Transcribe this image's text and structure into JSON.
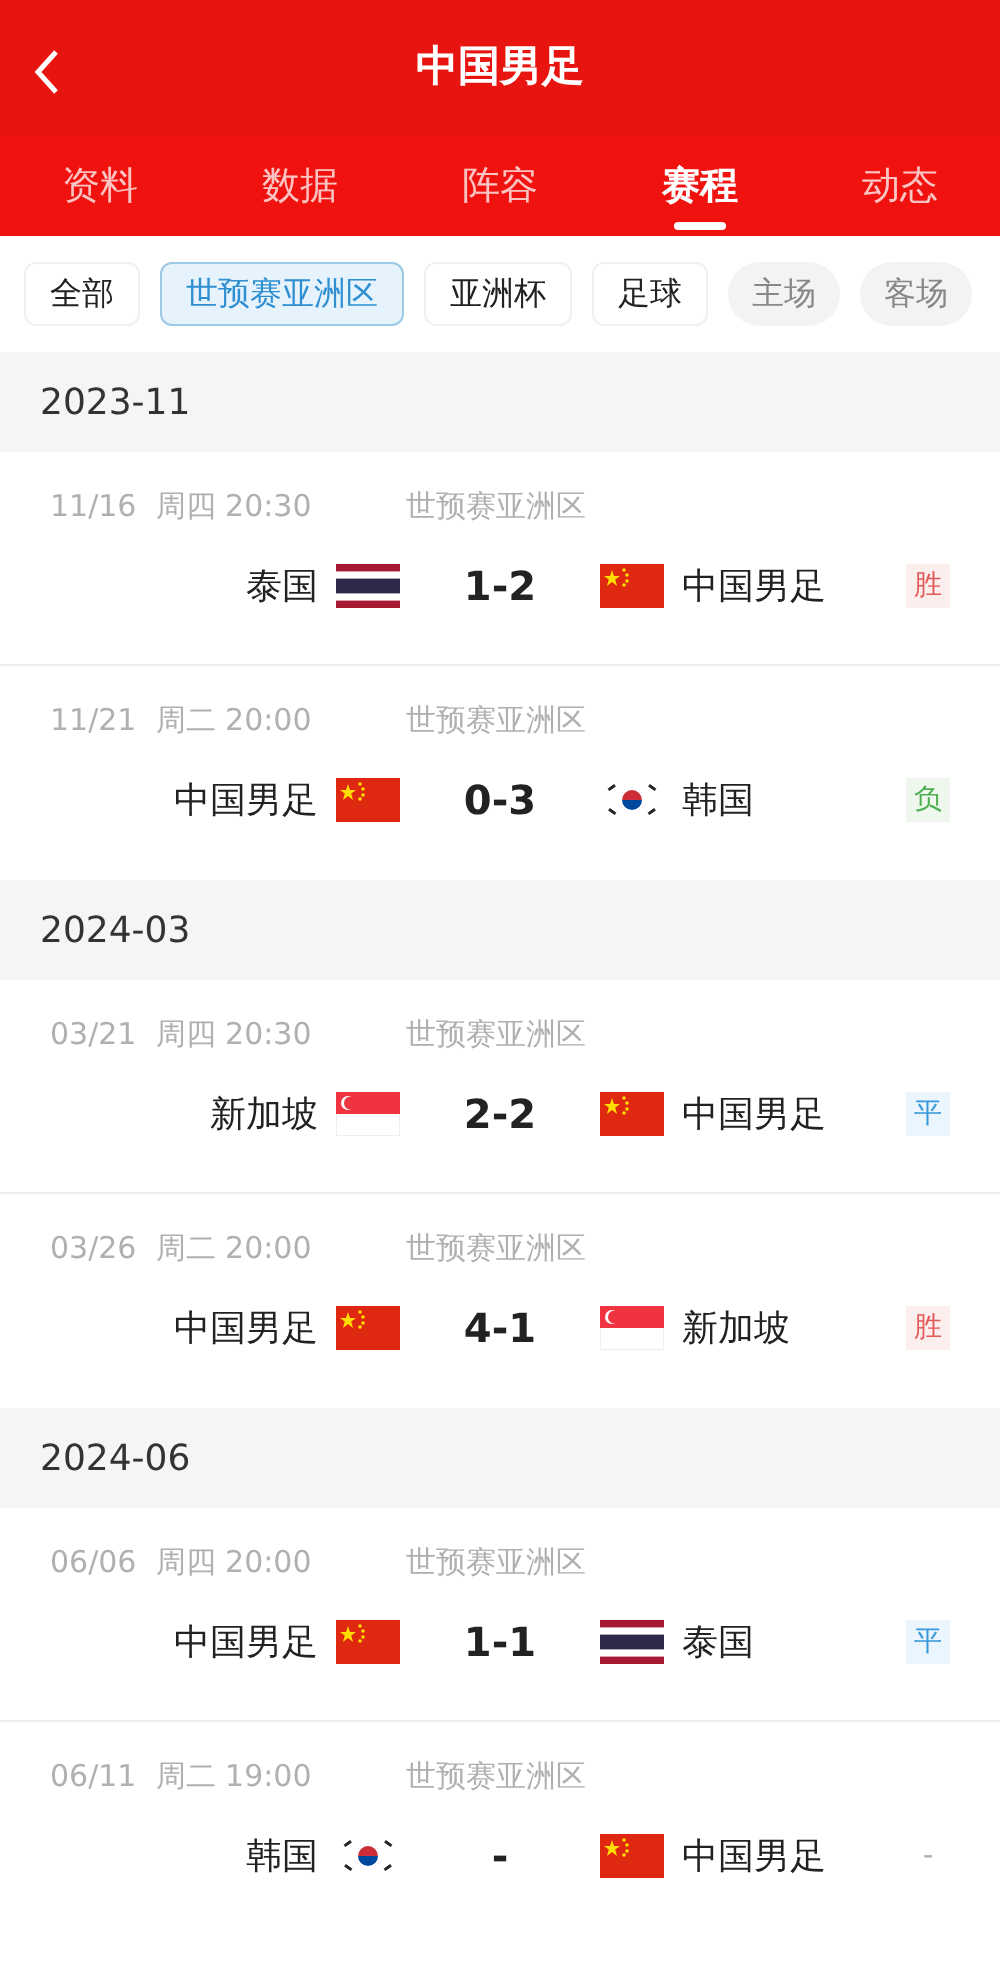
{
  "header": {
    "title": "中国男足"
  },
  "tabs": [
    {
      "label": "资料",
      "selected": false
    },
    {
      "label": "数据",
      "selected": false
    },
    {
      "label": "阵容",
      "selected": false
    },
    {
      "label": "赛程",
      "selected": true
    },
    {
      "label": "动态",
      "selected": false
    }
  ],
  "filters": [
    {
      "label": "全部",
      "kind": "category",
      "selected": false
    },
    {
      "label": "世预赛亚洲区",
      "kind": "category",
      "selected": true
    },
    {
      "label": "亚洲杯",
      "kind": "category",
      "selected": false
    },
    {
      "label": "足球",
      "kind": "category",
      "selected": false
    },
    {
      "label": "主场",
      "kind": "venue",
      "selected": false
    },
    {
      "label": "客场",
      "kind": "venue",
      "selected": false
    }
  ],
  "sections": [
    {
      "month": "2023-11",
      "matches": [
        {
          "time": "11/16  周四 20:30",
          "competition": "世预赛亚洲区",
          "home": {
            "name": "泰国",
            "flag": {
              "kind": "th"
            }
          },
          "score": "1-2",
          "away": {
            "name": "中国男足",
            "flag": {
              "kind": "cn"
            }
          },
          "result": {
            "text": "胜",
            "kind": "win"
          }
        },
        {
          "time": "11/21  周二 20:00",
          "competition": "世预赛亚洲区",
          "home": {
            "name": "中国男足",
            "flag": {
              "kind": "cn"
            }
          },
          "score": "0-3",
          "away": {
            "name": "韩国",
            "flag": {
              "kind": "kr"
            }
          },
          "result": {
            "text": "负",
            "kind": "loss"
          }
        }
      ]
    },
    {
      "month": "2024-03",
      "matches": [
        {
          "time": "03/21  周四 20:30",
          "competition": "世预赛亚洲区",
          "home": {
            "name": "新加坡",
            "flag": {
              "kind": "sg"
            }
          },
          "score": "2-2",
          "away": {
            "name": "中国男足",
            "flag": {
              "kind": "cn"
            }
          },
          "result": {
            "text": "平",
            "kind": "draw"
          }
        },
        {
          "time": "03/26  周二 20:00",
          "competition": "世预赛亚洲区",
          "home": {
            "name": "中国男足",
            "flag": {
              "kind": "cn"
            }
          },
          "score": "4-1",
          "away": {
            "name": "新加坡",
            "flag": {
              "kind": "sg"
            }
          },
          "result": {
            "text": "胜",
            "kind": "win"
          }
        }
      ]
    },
    {
      "month": "2024-06",
      "matches": [
        {
          "time": "06/06  周四 20:00",
          "competition": "世预赛亚洲区",
          "home": {
            "name": "中国男足",
            "flag": {
              "kind": "cn"
            }
          },
          "score": "1-1",
          "away": {
            "name": "泰国",
            "flag": {
              "kind": "th"
            }
          },
          "result": {
            "text": "平",
            "kind": "draw"
          }
        },
        {
          "time": "06/11  周二 19:00",
          "competition": "世预赛亚洲区",
          "home": {
            "name": "韩国",
            "flag": {
              "kind": "kr"
            }
          },
          "score": "-",
          "away": {
            "name": "中国男足",
            "flag": {
              "kind": "cn"
            }
          },
          "result": {
            "text": "-",
            "kind": "none"
          }
        }
      ]
    }
  ]
}
